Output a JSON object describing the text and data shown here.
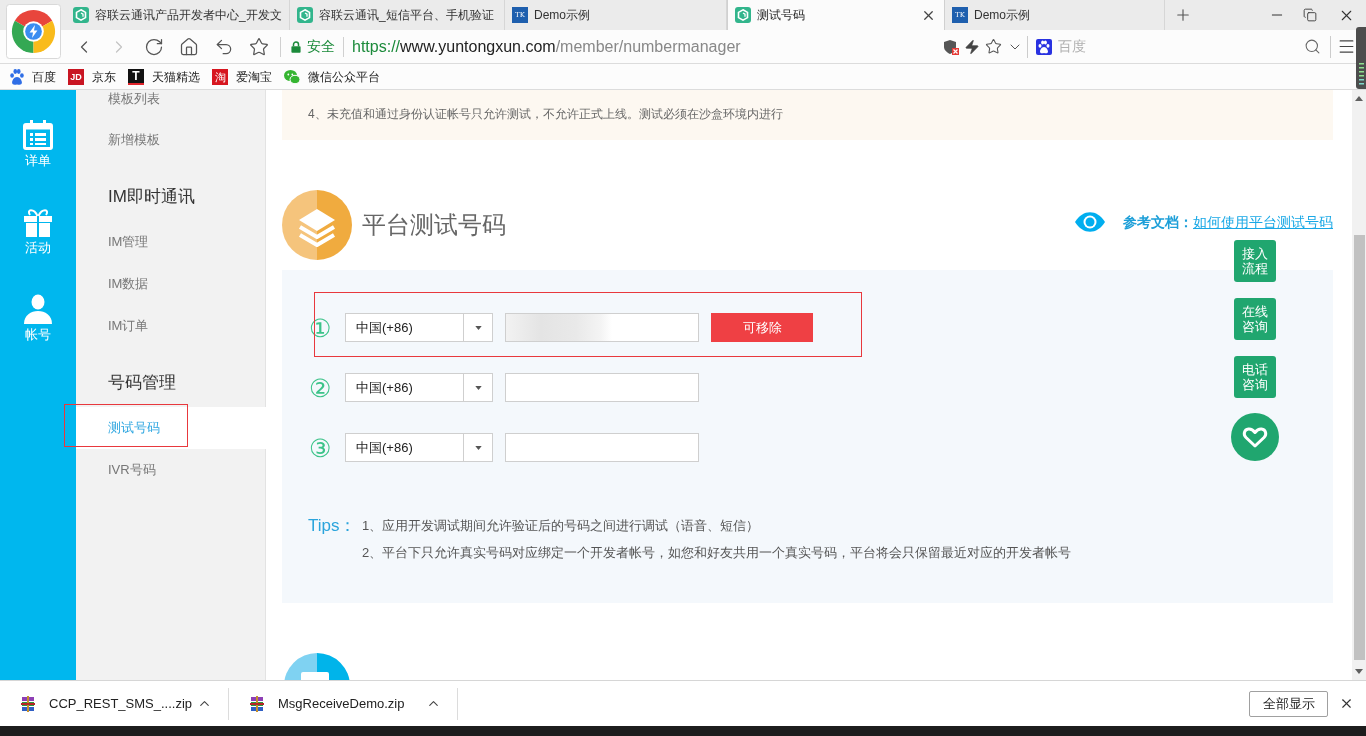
{
  "browser": {
    "tabs": [
      {
        "kind": "site",
        "title": "容联云通讯产品开发者中心_开发文",
        "selected": false
      },
      {
        "kind": "site",
        "title": "容联云通讯_短信平台、手机验证",
        "selected": false
      },
      {
        "kind": "tk",
        "badge": "TK",
        "title": "Demo示例",
        "selected": false
      },
      {
        "kind": "site",
        "title": "测试号码",
        "selected": true
      },
      {
        "kind": "tk",
        "badge": "TK",
        "title": "Demo示例",
        "selected": false
      }
    ],
    "forward_disabled": true,
    "address": {
      "secure_label": "安全",
      "url": {
        "scheme": "https://",
        "host": "www.yuntongxun.com",
        "path": "/member/numbermanager"
      }
    },
    "search": {
      "placeholder": "百度"
    },
    "bookmarks": [
      {
        "kind": "baidu",
        "label": "百度"
      },
      {
        "kind": "jd",
        "badge": "JD",
        "label": "京东"
      },
      {
        "kind": "tmall",
        "badge": "T",
        "label": "天猫精选"
      },
      {
        "kind": "taobao",
        "badge": "淘",
        "label": "爱淘宝"
      },
      {
        "kind": "wechat",
        "label": "微信公众平台"
      }
    ]
  },
  "rail": {
    "items": [
      {
        "kind": "calendar",
        "label": "详单"
      },
      {
        "kind": "gift",
        "label": "活动"
      },
      {
        "kind": "user",
        "label": "帐号"
      }
    ]
  },
  "menu": {
    "items": [
      {
        "kind": "link",
        "label": "模板列表",
        "selected": false,
        "highlighted": false
      },
      {
        "kind": "link",
        "label": "新增模板",
        "selected": false,
        "highlighted": false
      },
      {
        "kind": "heading",
        "label": "IM即时通讯"
      },
      {
        "kind": "link",
        "label": "IM管理",
        "selected": false,
        "highlighted": false
      },
      {
        "kind": "link",
        "label": "IM数据",
        "selected": false,
        "highlighted": false
      },
      {
        "kind": "link",
        "label": "IM订单",
        "selected": false,
        "highlighted": false
      },
      {
        "kind": "heading",
        "label": "号码管理"
      },
      {
        "kind": "link",
        "label": "测试号码",
        "selected": true,
        "highlighted": true
      },
      {
        "kind": "link",
        "label": "IVR号码",
        "selected": false,
        "highlighted": false
      }
    ]
  },
  "notice": {
    "text": "4、未充值和通过身份认证帐号只允许测试，不允许正式上线。测试必须在沙盒环境内进行"
  },
  "section": {
    "title": "平台测试号码",
    "doc_label": "参考文档：",
    "doc_link": "如何使用平台测试号码"
  },
  "numbers": [
    {
      "marker": "①",
      "country": "中国(+86)",
      "redacted": true,
      "action": "可移除",
      "highlighted": true
    },
    {
      "marker": "②",
      "country": "中国(+86)",
      "redacted": false,
      "highlighted": false
    },
    {
      "marker": "③",
      "country": "中国(+86)",
      "redacted": false,
      "highlighted": false
    }
  ],
  "tips": {
    "label": "Tips：",
    "lines": [
      "1、应用开发调试期间允许验证后的号码之间进行调试（语音、短信）",
      "2、平台下只允许真实号码对应绑定一个开发者帐号，如您和好友共用一个真实号码，平台将会只保留最近对应的开发者帐号"
    ]
  },
  "float_buttons": [
    {
      "kind": "text",
      "label": "接入流程"
    },
    {
      "kind": "text",
      "label": "在线咨询"
    },
    {
      "kind": "text",
      "label": "电话咨询"
    },
    {
      "kind": "heart"
    }
  ],
  "downloads": {
    "items": [
      {
        "name": "CCP_REST_SMS_....zip"
      },
      {
        "name": "MsgReceiveDemo.zip"
      }
    ],
    "show_all": "全部显示"
  }
}
